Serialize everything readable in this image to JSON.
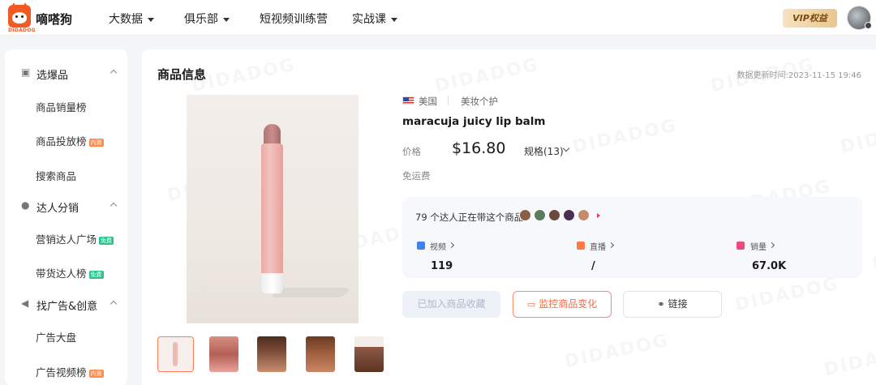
{
  "brand": {
    "name": "嘀嗒狗",
    "sub": "DIDADOG"
  },
  "nav": [
    {
      "label": "大数据",
      "dropdown": true
    },
    {
      "label": "俱乐部",
      "dropdown": true
    },
    {
      "label": "短视频训练营",
      "dropdown": false
    },
    {
      "label": "实战课",
      "dropdown": true
    }
  ],
  "vip": {
    "label": "VIP权益"
  },
  "sidebar": {
    "groups": [
      {
        "label": "选爆品",
        "icon": "box-icon",
        "items": [
          {
            "label": "商品销量榜",
            "tag": ""
          },
          {
            "label": "商品投放榜",
            "tag": "内测"
          },
          {
            "label": "搜索商品",
            "tag": ""
          }
        ]
      },
      {
        "label": "达人分销",
        "icon": "person-icon",
        "items": [
          {
            "label": "营销达人广场",
            "tag": "免费"
          },
          {
            "label": "带货达人榜",
            "tag": "免费"
          }
        ]
      },
      {
        "label": "找广告&创意",
        "icon": "megaphone-icon",
        "items": [
          {
            "label": "广告大盘",
            "tag": ""
          },
          {
            "label": "广告视频榜",
            "tag": "内测"
          }
        ]
      }
    ]
  },
  "main": {
    "title": "商品信息",
    "updated": "数据更新时间:2023-11-15 19:46",
    "watermark": "DIDADOG",
    "product": {
      "country": "美国",
      "category": "美妆个护",
      "name": "maracuja juicy lip balm",
      "price_label": "价格",
      "price": "$16.80",
      "spec": "规格(13)",
      "shipping": "免运费"
    },
    "stats": {
      "kol_text": "79 个达人正在带这个商品",
      "items": [
        {
          "label": "视频",
          "value": "119",
          "color": "#3b82f6"
        },
        {
          "label": "直播",
          "value": "/",
          "color": "#ff7a45"
        },
        {
          "label": "销量",
          "value": "67.0K",
          "color": "#ef4b7a"
        }
      ]
    },
    "buttons": {
      "favorite": "已加入商品收藏",
      "monitor": "监控商品变化",
      "link": "链接"
    }
  }
}
